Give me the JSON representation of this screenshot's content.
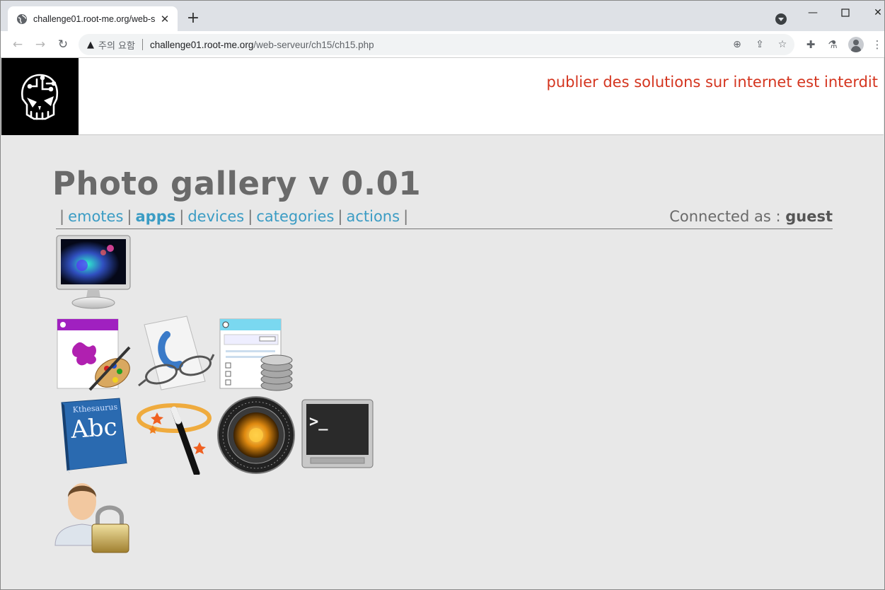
{
  "browser": {
    "tab_title": "challenge01.root-me.org/web-se",
    "new_tab": "+",
    "security_label": "주의 요함",
    "url_host": "challenge01.root-me.org",
    "url_path": "/web-serveur/ch15/ch15.php"
  },
  "banner": {
    "warning": "publier des solutions sur internet est interdit"
  },
  "gallery": {
    "title": "Photo gallery v 0.01",
    "menu": [
      {
        "label": "emotes"
      },
      {
        "label": "apps",
        "active": true
      },
      {
        "label": "devices"
      },
      {
        "label": "categories"
      },
      {
        "label": "actions"
      }
    ],
    "connected_prefix": "Connected as :",
    "user": "guest",
    "images": [
      {
        "name": "monitor-icon"
      },
      {
        "name": "paint-palette-icon"
      },
      {
        "name": "writer-glasses-icon"
      },
      {
        "name": "form-database-icon"
      },
      {
        "name": "thesaurus-book-icon"
      },
      {
        "name": "magic-wand-icon"
      },
      {
        "name": "camera-lens-icon"
      },
      {
        "name": "terminal-icon"
      },
      {
        "name": "user-lock-icon"
      }
    ],
    "thesaurus_book_text": "Kthesaurus",
    "thesaurus_book_abc": "Abc",
    "terminal_prompt": ">_"
  }
}
